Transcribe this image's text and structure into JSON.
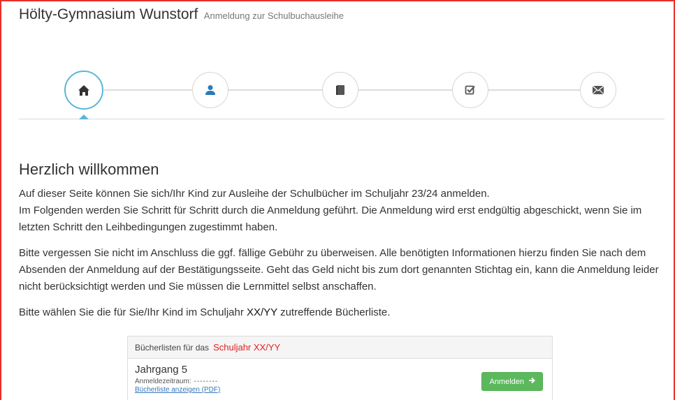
{
  "header": {
    "school": "Hölty-Gymnasium Wunstorf",
    "subtitle": "Anmeldung zur Schulbuchausleihe"
  },
  "steps": [
    {
      "icon": "home-icon",
      "active": true
    },
    {
      "icon": "user-icon",
      "active": false
    },
    {
      "icon": "book-icon",
      "active": false
    },
    {
      "icon": "check-square-icon",
      "active": false
    },
    {
      "icon": "envelope-icon",
      "active": false
    }
  ],
  "colors": {
    "accent": "#5bb6d6",
    "button": "#5cb85c",
    "highlight": "#e02020",
    "border": "#e8302a"
  },
  "welcome": {
    "title": "Herzlich willkommen",
    "p1_line1": "Auf dieser Seite können Sie sich/Ihr Kind zur Ausleihe der Schulbücher im Schuljahr 23/24 anmelden.",
    "p1_line2": "Im Folgenden werden Sie Schritt für Schritt durch die Anmeldung geführt. Die Anmeldung wird erst endgültig abgeschickt, wenn Sie im letzten Schritt den Leihbedingungen zugestimmt haben.",
    "p2": "Bitte vergessen Sie nicht im Anschluss die ggf. fällige Gebühr zu überweisen. Alle benötigten Informationen hierzu finden Sie nach dem Absenden der Anmeldung auf der Bestätigungsseite. Geht das Geld nicht bis zum dort genannten Stichtag ein, kann die Anmeldung leider nicht berücksichtigt werden und Sie müssen die Lernmittel selbst anschaffen.",
    "p3_before": "Bitte wählen Sie die für Sie/Ihr Kind im Schuljahr",
    "p3_year": "XX/YY",
    "p3_after": "zutreffende Bücherliste."
  },
  "panel": {
    "heading": "Bücherlisten für das",
    "heading_year": "Schuljahr XX/YY",
    "grade": "Jahrgang 5",
    "period_label": "Anmeldezeitraum:",
    "period_value": "--------",
    "pdf_link": "Bücherliste anzeigen (PDF)",
    "button_label": "Anmelden"
  }
}
